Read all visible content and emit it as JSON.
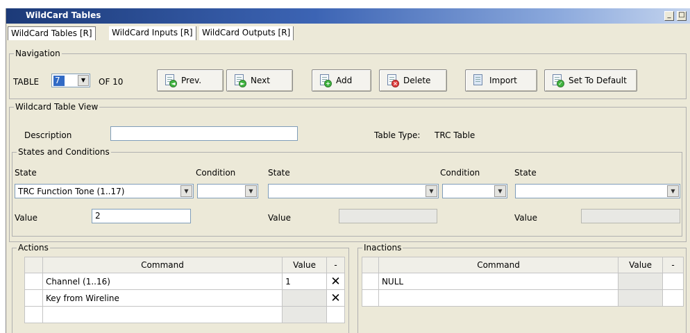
{
  "window": {
    "title": "WildCard Tables",
    "minimize": "_",
    "maximize": "□"
  },
  "tabs": [
    "WildCard Tables [R]",
    "WildCard Inputs [R]",
    "WildCard Outputs [R]"
  ],
  "navigation": {
    "group_label": "Navigation",
    "table_label": "TABLE",
    "table_value": "7",
    "of_label": "OF 10",
    "buttons": {
      "prev": "Prev.",
      "next": "Next",
      "add": "Add",
      "delete": "Delete",
      "import": "Import",
      "set_default": "Set To Default"
    }
  },
  "view": {
    "group_label": "Wildcard Table View",
    "description_label": "Description",
    "description_value": "",
    "table_type_label": "Table Type:",
    "table_type_value": "TRC Table"
  },
  "states": {
    "group_label": "States and Conditions",
    "state_label": "State",
    "condition_label": "Condition",
    "value_label": "Value",
    "state1_value": "TRC Function Tone (1..17)",
    "value1": "2"
  },
  "actions": {
    "group_label": "Actions",
    "columns": {
      "command": "Command",
      "value": "Value",
      "minus": "-"
    },
    "rows": [
      {
        "command": "Channel (1..16)",
        "value": "1",
        "delete": "✕"
      },
      {
        "command": "Key from Wireline",
        "value": "",
        "delete": "✕"
      }
    ]
  },
  "inactions": {
    "group_label": "Inactions",
    "columns": {
      "command": "Command",
      "value": "Value",
      "minus": "-"
    },
    "rows": [
      {
        "command": "NULL",
        "value": ""
      }
    ]
  }
}
